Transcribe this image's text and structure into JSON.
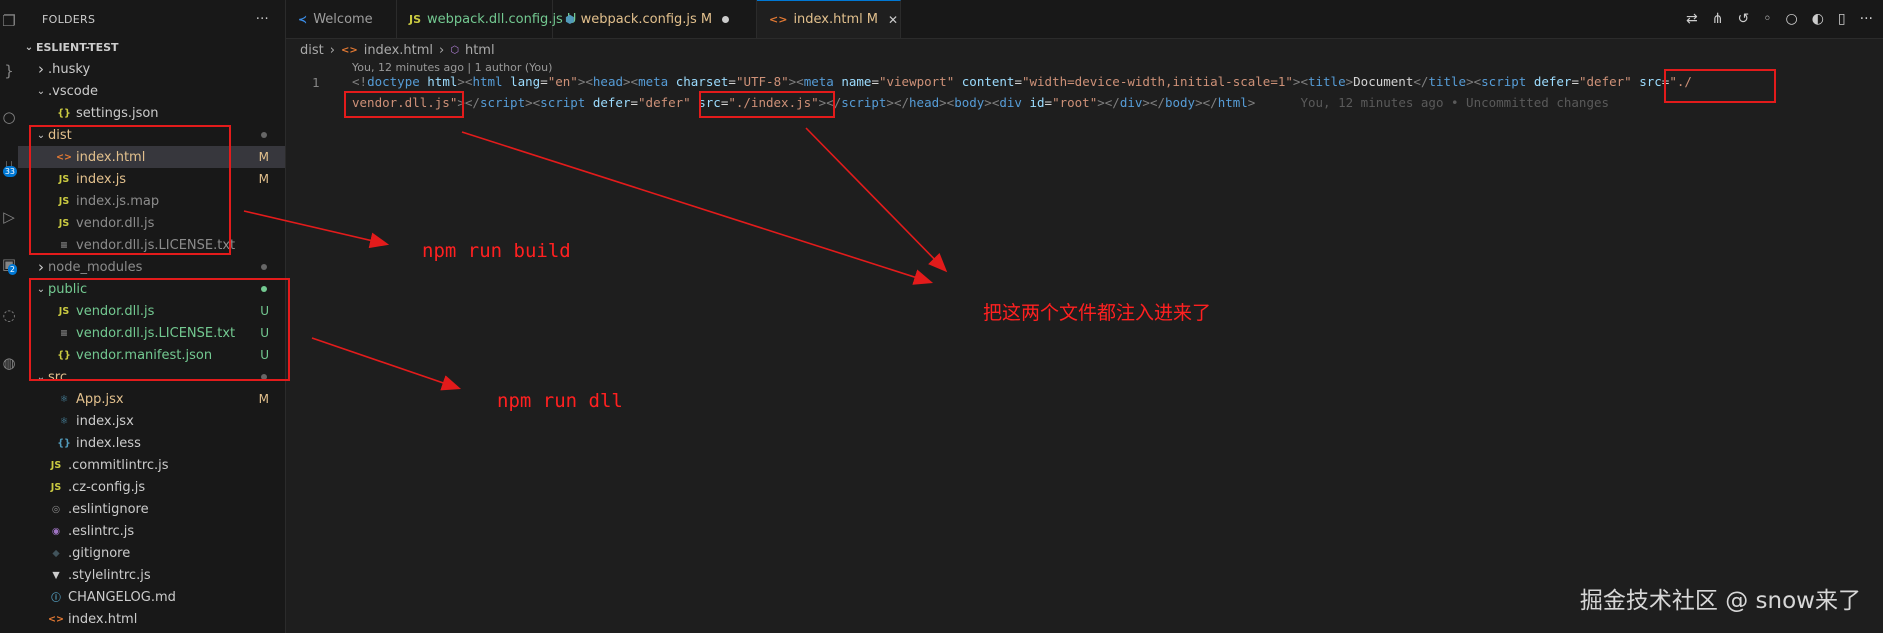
{
  "sidebar": {
    "header": "FOLDERS",
    "more": "···",
    "root": "ESLIENT-TEST",
    "items": [
      {
        "label": ".husky",
        "indent": 1,
        "chevron": "right",
        "icon": "",
        "color": "#cccccc",
        "badge": "",
        "dot": false
      },
      {
        "label": ".vscode",
        "indent": 1,
        "chevron": "down",
        "icon": "",
        "color": "#cccccc",
        "badge": "",
        "dot": false
      },
      {
        "label": "settings.json",
        "indent": 2,
        "chevron": "",
        "icon": "{}",
        "iconColor": "#cbcb41",
        "color": "#cccccc",
        "badge": "",
        "dot": false
      },
      {
        "label": "dist",
        "indent": 1,
        "chevron": "down",
        "icon": "",
        "color": "#e2c08d",
        "badge": "",
        "dot": true
      },
      {
        "label": "index.html",
        "indent": 2,
        "chevron": "",
        "icon": "<>",
        "iconColor": "#e37933",
        "color": "#e2c08d",
        "badge": "M",
        "badgeColor": "#e2c08d",
        "dot": false,
        "selected": true
      },
      {
        "label": "index.js",
        "indent": 2,
        "chevron": "",
        "icon": "JS",
        "iconColor": "#cbcb41",
        "color": "#e2c08d",
        "badge": "M",
        "badgeColor": "#e2c08d",
        "dot": false
      },
      {
        "label": "index.js.map",
        "indent": 2,
        "chevron": "",
        "icon": "JS",
        "iconColor": "#cbcb41",
        "color": "#8c8c8c",
        "badge": "",
        "dot": false
      },
      {
        "label": "vendor.dll.js",
        "indent": 2,
        "chevron": "",
        "icon": "JS",
        "iconColor": "#cbcb41",
        "color": "#8c8c8c",
        "badge": "",
        "dot": false
      },
      {
        "label": "vendor.dll.js.LICENSE.txt",
        "indent": 2,
        "chevron": "",
        "icon": "≡",
        "iconColor": "#8c8c8c",
        "color": "#8c8c8c",
        "badge": "",
        "dot": false
      },
      {
        "label": "node_modules",
        "indent": 1,
        "chevron": "right",
        "icon": "",
        "color": "#8c8c8c",
        "badge": "",
        "dot": true
      },
      {
        "label": "public",
        "indent": 1,
        "chevron": "down",
        "icon": "",
        "color": "#73c991",
        "badge": "",
        "dot": true,
        "dotColor": "#73c991"
      },
      {
        "label": "vendor.dll.js",
        "indent": 2,
        "chevron": "",
        "icon": "JS",
        "iconColor": "#cbcb41",
        "color": "#73c991",
        "badge": "U",
        "badgeColor": "#73c991",
        "dot": false
      },
      {
        "label": "vendor.dll.js.LICENSE.txt",
        "indent": 2,
        "chevron": "",
        "icon": "≡",
        "iconColor": "#8c8c8c",
        "color": "#73c991",
        "badge": "U",
        "badgeColor": "#73c991",
        "dot": false
      },
      {
        "label": "vendor.manifest.json",
        "indent": 2,
        "chevron": "",
        "icon": "{}",
        "iconColor": "#cbcb41",
        "color": "#73c991",
        "badge": "U",
        "badgeColor": "#73c991",
        "dot": false
      },
      {
        "label": "src",
        "indent": 1,
        "chevron": "down",
        "icon": "",
        "color": "#e2c08d",
        "badge": "",
        "dot": true
      },
      {
        "label": "App.jsx",
        "indent": 2,
        "chevron": "",
        "icon": "⚛",
        "iconColor": "#519aba",
        "color": "#e2c08d",
        "badge": "M",
        "badgeColor": "#e2c08d",
        "dot": false
      },
      {
        "label": "index.jsx",
        "indent": 2,
        "chevron": "",
        "icon": "⚛",
        "iconColor": "#519aba",
        "color": "#cccccc",
        "badge": "",
        "dot": false
      },
      {
        "label": "index.less",
        "indent": 2,
        "chevron": "",
        "icon": "{}",
        "iconColor": "#519aba",
        "color": "#cccccc",
        "badge": "",
        "dot": false
      },
      {
        "label": ".commitlintrc.js",
        "indent": 1,
        "chevron": "",
        "icon": "JS",
        "iconColor": "#cbcb41",
        "color": "#cccccc",
        "badge": "",
        "dot": false
      },
      {
        "label": ".cz-config.js",
        "indent": 1,
        "chevron": "",
        "icon": "JS",
        "iconColor": "#cbcb41",
        "color": "#cccccc",
        "badge": "",
        "dot": false
      },
      {
        "label": ".eslintignore",
        "indent": 1,
        "chevron": "",
        "icon": "◎",
        "iconColor": "#8c8c8c",
        "color": "#cccccc",
        "badge": "",
        "dot": false
      },
      {
        "label": ".eslintrc.js",
        "indent": 1,
        "chevron": "",
        "icon": "◉",
        "iconColor": "#a074c4",
        "color": "#cccccc",
        "badge": "",
        "dot": false
      },
      {
        "label": ".gitignore",
        "indent": 1,
        "chevron": "",
        "icon": "◆",
        "iconColor": "#41535b",
        "color": "#cccccc",
        "badge": "",
        "dot": false
      },
      {
        "label": ".stylelintrc.js",
        "indent": 1,
        "chevron": "",
        "icon": "▼",
        "iconColor": "#cccccc",
        "color": "#cccccc",
        "badge": "",
        "dot": false
      },
      {
        "label": "CHANGELOG.md",
        "indent": 1,
        "chevron": "",
        "icon": "ⓘ",
        "iconColor": "#519aba",
        "color": "#cccccc",
        "badge": "",
        "dot": false
      },
      {
        "label": "index.html",
        "indent": 1,
        "chevron": "",
        "icon": "<>",
        "iconColor": "#e37933",
        "color": "#cccccc",
        "badge": "",
        "dot": false
      }
    ]
  },
  "tabs": [
    {
      "label": "Welcome",
      "icon": "≺",
      "iconColor": "#3b8eea",
      "color": "#9d9d9d",
      "status": "",
      "active": false
    },
    {
      "label": "webpack.dll.config.js",
      "icon": "JS",
      "iconColor": "#cbcb41",
      "color": "#73c991",
      "status": "U",
      "statusColor": "#73c991",
      "active": false
    },
    {
      "label": "webpack.config.js",
      "icon": "⬢",
      "iconColor": "#519aba",
      "color": "#e2c08d",
      "status": "M",
      "statusColor": "#e2c08d",
      "active": false,
      "dirtyDot": true
    },
    {
      "label": "index.html",
      "icon": "<>",
      "iconColor": "#e37933",
      "color": "#e2c08d",
      "status": "M",
      "statusColor": "#e2c08d",
      "active": true,
      "close": "✕"
    }
  ],
  "breadcrumb": {
    "parts": [
      "dist",
      "index.html",
      "html"
    ],
    "sep": "›"
  },
  "editor": {
    "codelens": "You, 12 minutes ago | 1 author (You)",
    "line_number": "1",
    "blame": "You, 12 minutes ago • Uncommitted changes",
    "line1": [
      [
        "pun",
        "<!"
      ],
      [
        "tag",
        "doctype"
      ],
      [
        "txt",
        " "
      ],
      [
        "att",
        "html"
      ],
      [
        "pun",
        ">"
      ],
      [
        "pun",
        "<"
      ],
      [
        "tag",
        "html"
      ],
      [
        "txt",
        " "
      ],
      [
        "att",
        "lang"
      ],
      [
        "txt",
        "="
      ],
      [
        "str",
        "\"en\""
      ],
      [
        "pun",
        ">"
      ],
      [
        "pun",
        "<"
      ],
      [
        "tag",
        "head"
      ],
      [
        "pun",
        ">"
      ],
      [
        "pun",
        "<"
      ],
      [
        "tag",
        "meta"
      ],
      [
        "txt",
        " "
      ],
      [
        "att",
        "charset"
      ],
      [
        "txt",
        "="
      ],
      [
        "str",
        "\"UTF-8\""
      ],
      [
        "pun",
        ">"
      ],
      [
        "pun",
        "<"
      ],
      [
        "tag",
        "meta"
      ],
      [
        "txt",
        " "
      ],
      [
        "att",
        "name"
      ],
      [
        "txt",
        "="
      ],
      [
        "str",
        "\"viewport\""
      ],
      [
        "txt",
        " "
      ],
      [
        "att",
        "content"
      ],
      [
        "txt",
        "="
      ],
      [
        "str",
        "\"width=device-width,initial-scale=1\""
      ],
      [
        "pun",
        ">"
      ],
      [
        "pun",
        "<"
      ],
      [
        "tag",
        "title"
      ],
      [
        "pun",
        ">"
      ],
      [
        "txt",
        "Document"
      ],
      [
        "pun",
        "</"
      ],
      [
        "tag",
        "title"
      ],
      [
        "pun",
        ">"
      ],
      [
        "pun",
        "<"
      ],
      [
        "tag",
        "script"
      ],
      [
        "txt",
        " "
      ],
      [
        "att",
        "defer"
      ],
      [
        "txt",
        "="
      ],
      [
        "str",
        "\"defer\""
      ],
      [
        "txt",
        " "
      ],
      [
        "att",
        "src"
      ],
      [
        "txt",
        "="
      ],
      [
        "str",
        "\"./"
      ]
    ],
    "line2": [
      [
        "str",
        "vendor.dll.js\""
      ],
      [
        "pun",
        ">"
      ],
      [
        "pun",
        "</"
      ],
      [
        "tag",
        "script"
      ],
      [
        "pun",
        ">"
      ],
      [
        "pun",
        "<"
      ],
      [
        "tag",
        "script"
      ],
      [
        "txt",
        " "
      ],
      [
        "att",
        "defer"
      ],
      [
        "txt",
        "="
      ],
      [
        "str",
        "\"defer\""
      ],
      [
        "txt",
        " "
      ],
      [
        "att",
        "src"
      ],
      [
        "txt",
        "="
      ],
      [
        "str",
        "\"./index.js\""
      ],
      [
        "pun",
        ">"
      ],
      [
        "pun",
        "</"
      ],
      [
        "tag",
        "script"
      ],
      [
        "pun",
        ">"
      ],
      [
        "pun",
        "</"
      ],
      [
        "tag",
        "head"
      ],
      [
        "pun",
        ">"
      ],
      [
        "pun",
        "<"
      ],
      [
        "tag",
        "body"
      ],
      [
        "pun",
        ">"
      ],
      [
        "pun",
        "<"
      ],
      [
        "tag",
        "div"
      ],
      [
        "txt",
        " "
      ],
      [
        "att",
        "id"
      ],
      [
        "txt",
        "="
      ],
      [
        "str",
        "\"root\""
      ],
      [
        "pun",
        ">"
      ],
      [
        "pun",
        "</"
      ],
      [
        "tag",
        "div"
      ],
      [
        "pun",
        ">"
      ],
      [
        "pun",
        "</"
      ],
      [
        "tag",
        "body"
      ],
      [
        "pun",
        ">"
      ],
      [
        "pun",
        "</"
      ],
      [
        "tag",
        "html"
      ],
      [
        "pun",
        ">"
      ]
    ]
  },
  "annotations": {
    "build": "npm run build",
    "dll": "npm run dll",
    "inject": "把这两个文件都注入进来了",
    "color": "#e31b1b"
  },
  "watermark": "掘金技术社区 @ snow来了",
  "activity": [
    {
      "icon": "files-icon",
      "glyph": "❐"
    },
    {
      "icon": "braces-icon",
      "glyph": "}"
    },
    {
      "icon": "search-icon",
      "glyph": "○"
    },
    {
      "icon": "source-control-icon",
      "glyph": "⑂",
      "badge": "33"
    },
    {
      "icon": "run-debug-icon",
      "glyph": "▷"
    },
    {
      "icon": "extensions-icon",
      "glyph": "▣",
      "badge": "2"
    },
    {
      "icon": "remote-icon",
      "glyph": "◌"
    },
    {
      "icon": "docker-icon",
      "glyph": "◍"
    }
  ]
}
